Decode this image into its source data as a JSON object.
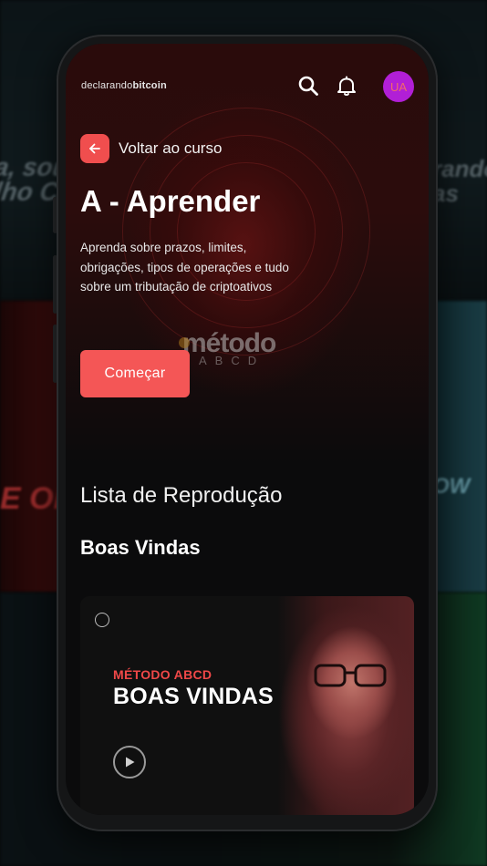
{
  "background": {
    "left_top_1": "a, sou",
    "left_top_2": "lho Co",
    "right_top_1": "rando",
    "right_top_2": "as",
    "left_mid": "E OF",
    "right_mid": "OW"
  },
  "header": {
    "brand_prefix": "declarando",
    "brand_suffix": "bitcoin",
    "search_icon": "search-icon",
    "bell_icon": "bell-icon",
    "avatar_initials": "UA"
  },
  "hero": {
    "back_label": "Voltar ao curso",
    "title": "A - Aprender",
    "description": "Aprenda sobre prazos, limites, obrigações, tipos de operações e tudo sobre um tributação de criptoativos",
    "logo_word": "método",
    "logo_sub": "ABCD",
    "start_label": "Começar"
  },
  "playlist": {
    "heading": "Lista de Reprodução",
    "section_title": "Boas Vindas",
    "card": {
      "kicker": "MÉTODO ABCD",
      "title": "BOAS VINDAS",
      "play_icon": "play-icon"
    }
  },
  "colors": {
    "accent": "#f45656",
    "avatar_bg": "#b11fd6",
    "kicker": "#f04848"
  }
}
